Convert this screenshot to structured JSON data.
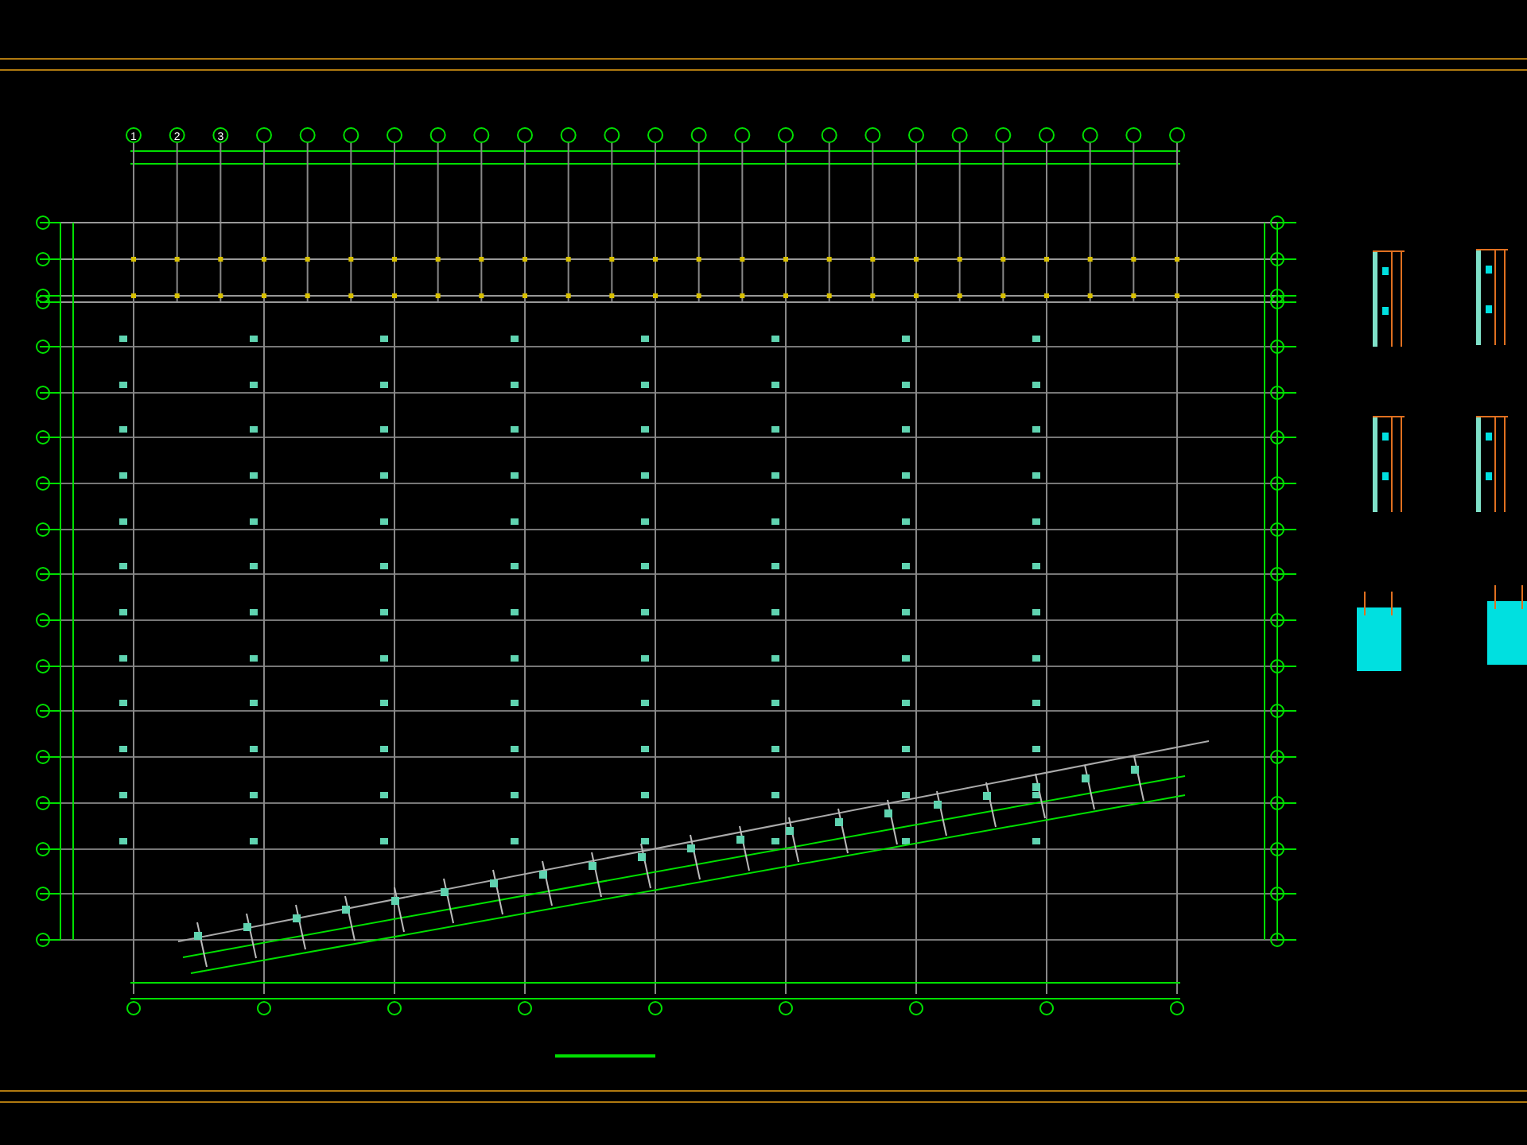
{
  "drawing": {
    "kind": "floor-plan",
    "top_axis": [
      {
        "label": "1"
      },
      {
        "label": "2"
      },
      {
        "label": "3"
      }
    ]
  }
}
